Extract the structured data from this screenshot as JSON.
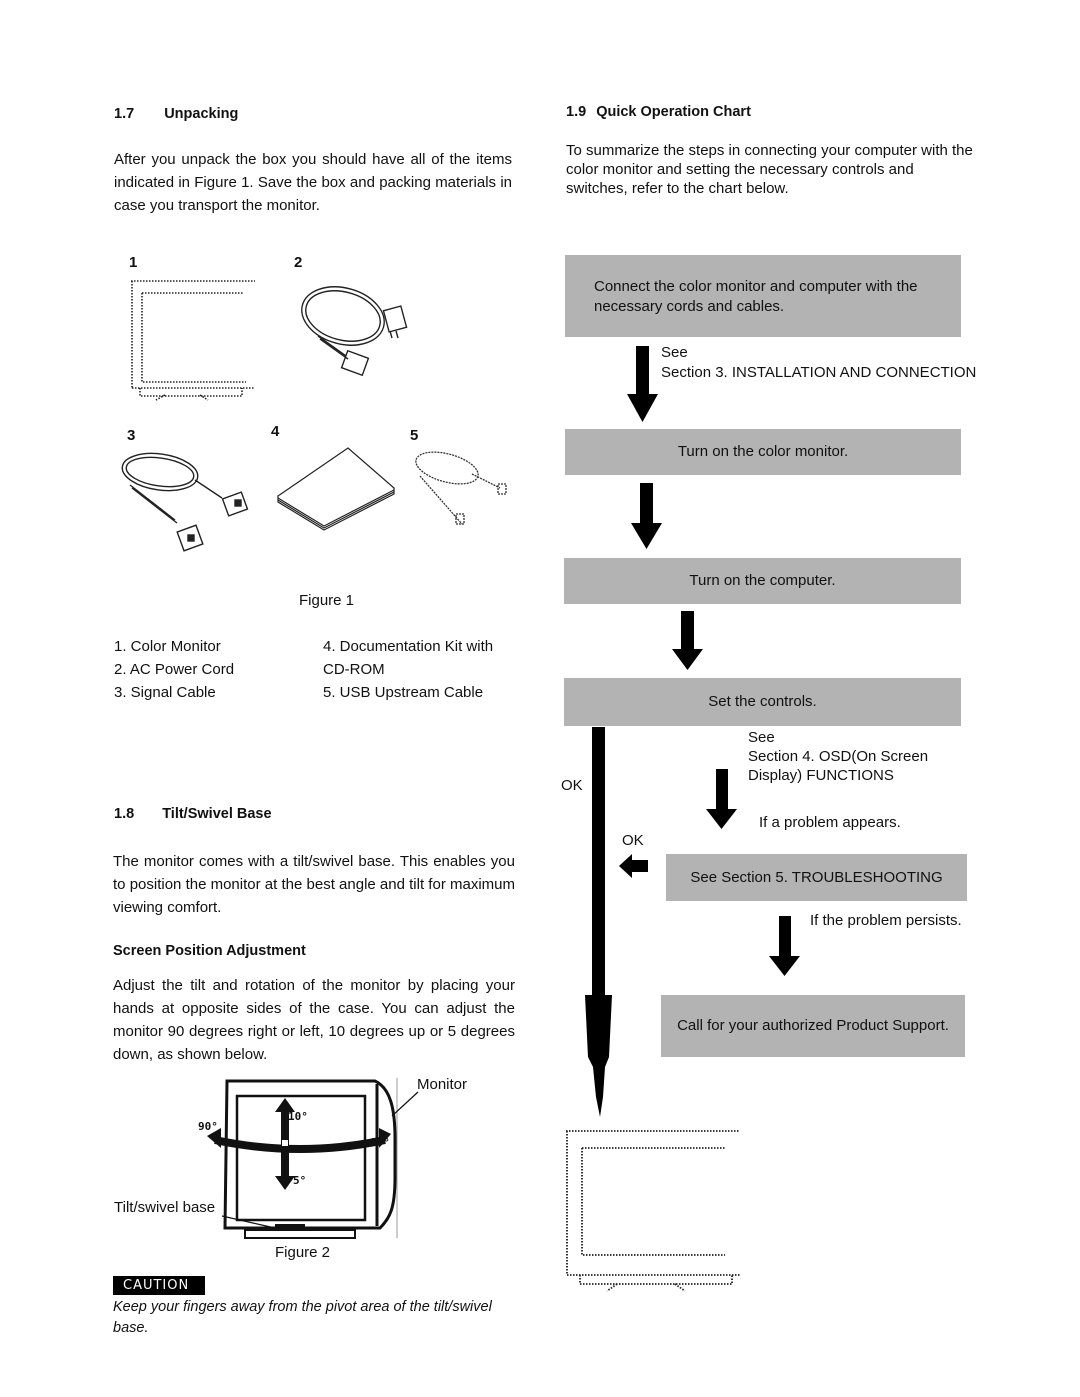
{
  "left": {
    "unpacking": {
      "number": "1.7",
      "title": "Unpacking",
      "paragraph": "After you unpack the box you should have all of the items indicated in Figure 1.  Save the box and packing materials in case you  transport the monitor.",
      "figure_numbers": [
        "1",
        "2",
        "3",
        "4",
        "5"
      ],
      "figure_caption": "Figure 1",
      "items_col1": [
        "1.  Color Monitor",
        "2.  AC Power Cord",
        "3.  Signal Cable"
      ],
      "items_col2": [
        "4.  Documentation Kit with",
        "CD-ROM",
        "5.  USB Upstream Cable"
      ]
    },
    "tilt": {
      "number": "1.8",
      "title": "Tilt/Swivel Base",
      "paragraph": "The monitor comes with a tilt/swivel base. This enables you to position the monitor at  the best angle and tilt for maximum viewing comfort.",
      "subheading": "Screen Position Adjustment",
      "paragraph2": "Adjust the tilt and rotation of the monitor by placing your hands at opposite sides of the case.  You can adjust the monitor 90 degrees right or left, 10 degrees up or 5 degrees down, as shown below.",
      "figure_labels": {
        "monitor": "Monitor",
        "base": "Tilt/swivel base",
        "up": "10°",
        "down": "5°",
        "left": "90°",
        "right": "90°"
      },
      "figure_caption": "Figure 2",
      "caution_label": "CAUTION",
      "caution_text": "Keep your fingers away from the pivot area of the tilt/swivel base."
    }
  },
  "right": {
    "number": "1.9",
    "title": "Quick Operation Chart",
    "paragraph": "To summarize the steps in connecting your computer with the color monitor and setting the necessary controls and switches, refer to the chart below.",
    "chart": {
      "box_color": "#b3b3b3",
      "steps": [
        "Connect the color monitor and computer with the necessary cords and cables.",
        "Turn on the color monitor.",
        "Turn on the computer.",
        "Set the controls.",
        "See Section 5. TROUBLESHOOTING",
        "Call for your authorized Product Support."
      ],
      "notes": {
        "see": "See",
        "section3": "Section 3. INSTALLATION AND CONNECTION",
        "see2": "See",
        "section4a": "Section 4. OSD(On Screen",
        "section4b": "Display) FUNCTIONS",
        "problem_appears": "If a problem appears.",
        "problem_persists": "If the problem persists.",
        "ok_main": "OK",
        "ok_side": "OK"
      }
    }
  }
}
